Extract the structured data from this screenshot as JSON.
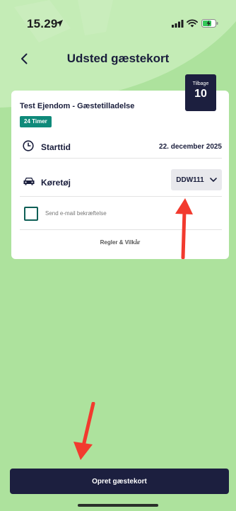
{
  "status_bar": {
    "time": "15.29"
  },
  "nav": {
    "title": "Udsted gæstekort"
  },
  "badge": {
    "label": "Tilbage",
    "value": "10"
  },
  "card": {
    "title": "Test Ejendom - Gæstetilladelse",
    "duration": "24 Timer",
    "start": {
      "label": "Starttid",
      "value": "22. december 2025"
    },
    "vehicle": {
      "label": "Køretøj",
      "selected": "DDW111"
    },
    "email_confirmation": {
      "label": "Send e-mail bekræftelse",
      "checked": false
    },
    "terms_link": "Regler & Vilkår"
  },
  "footer": {
    "submit_label": "Opret gæstekort"
  },
  "colors": {
    "background": "#ade29d",
    "primary": "#1c1f3f",
    "accent": "#0f8a7a",
    "annotation_arrow": "#f23a2e"
  },
  "icons": {
    "back": "chevron-left-icon",
    "start": "clock-icon",
    "vehicle": "car-icon",
    "select": "chevron-down-icon"
  }
}
